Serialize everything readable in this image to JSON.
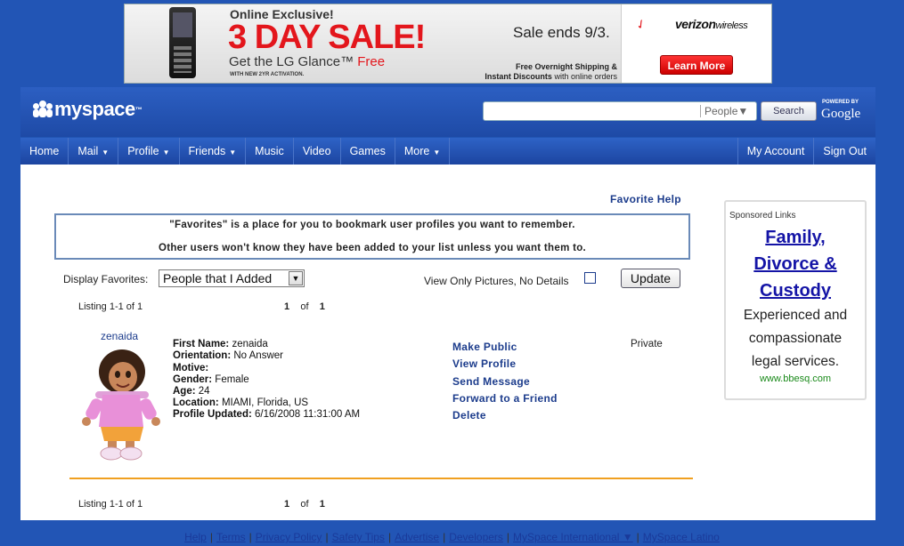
{
  "banner": {
    "exclusive": "Online Exclusive!",
    "headline": "3 DAY SALE!",
    "product": "Get the LG Glance™",
    "product_free": "Free",
    "activation": "WITH NEW 2YR ACTIVATION.",
    "sale_ends": "Sale ends 9/3.",
    "shipping": "Free Overnight Shipping &",
    "instant_bold": "Instant Discounts",
    "instant_rest": "with online orders",
    "brand": "verizon",
    "brand_suffix": "wireless",
    "learn_more": "Learn More"
  },
  "header": {
    "logo": "myspace",
    "logo_tm": "™",
    "search_value": "",
    "search_scope": "People▼",
    "search_button": "Search",
    "powered_by": "POWERED BY",
    "google": "Google"
  },
  "nav": {
    "left": [
      {
        "label": "Home",
        "caret": ""
      },
      {
        "label": "Mail",
        "caret": "▼"
      },
      {
        "label": "Profile",
        "caret": "▼"
      },
      {
        "label": "Friends",
        "caret": "▼"
      },
      {
        "label": "Music",
        "caret": ""
      },
      {
        "label": "Video",
        "caret": ""
      },
      {
        "label": "Games",
        "caret": ""
      },
      {
        "label": "More",
        "caret": "▼"
      }
    ],
    "right": [
      {
        "label": "My Account"
      },
      {
        "label": "Sign Out"
      }
    ]
  },
  "content": {
    "favorite_help": "Favorite Help",
    "info_line1": "\"Favorites\" is a place for you to bookmark user profiles you want to remember.",
    "info_line2": "Other users won't know they have been added to your list unless you want them to.",
    "display_label": "Display Favorites:",
    "display_value": "People that I Added",
    "pictures_only_label": "View Only Pictures, No Details",
    "update_button": "Update",
    "listing": "Listing 1-1 of 1",
    "pager": {
      "current": "1",
      "of": "of",
      "total": "1"
    }
  },
  "profile": {
    "display_name": "zenaida",
    "fields": [
      {
        "label": "First Name:",
        "value": "zenaida"
      },
      {
        "label": "Orientation:",
        "value": "No Answer"
      },
      {
        "label": "Motive:",
        "value": ""
      },
      {
        "label": "Gender:",
        "value": "Female"
      },
      {
        "label": "Age:",
        "value": "24"
      },
      {
        "label": "Location:",
        "value": "MIAMI, Florida, US"
      },
      {
        "label": "Profile Updated:",
        "value": "6/16/2008 11:31:00 AM"
      }
    ],
    "actions": [
      "Make Public",
      "View Profile",
      "Send Message",
      "Forward to a Friend",
      "Delete"
    ],
    "privacy": "Private"
  },
  "sponsored": {
    "title": "Sponsored Links",
    "headline": [
      "Family,",
      "Divorce &",
      "Custody"
    ],
    "body": [
      "Experienced and",
      "compassionate",
      "legal services."
    ],
    "url": "www.bbesq.com"
  },
  "footer": {
    "links": [
      "Help",
      "Terms",
      "Privacy Policy",
      "Safety Tips",
      "Advertise",
      "Developers",
      "MySpace International ▼",
      "MySpace Latino"
    ]
  },
  "colors": {
    "brand_blue": "#2255b5",
    "link_blue": "#1c3c8c",
    "ad_red": "#e3161c",
    "divider_orange": "#f0a020"
  }
}
